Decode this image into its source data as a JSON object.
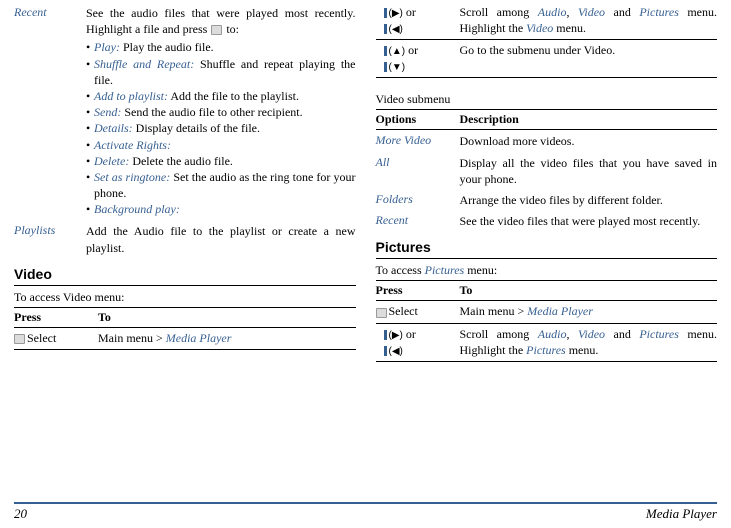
{
  "left": {
    "recent": {
      "label": "Recent",
      "desc_pre": "See the audio files that were played most recently. Highlight a file and press",
      "desc_post": "to:",
      "bullets": [
        {
          "term": "Play:",
          "desc": " Play the audio file."
        },
        {
          "term": "Shuffle and Repeat:",
          "desc": " Shuffle and repeat playing the file."
        },
        {
          "term": "Add to playlist:",
          "desc": " Add the file to the playlist."
        },
        {
          "term": "Send:",
          "desc": " Send the audio file to other recipient."
        },
        {
          "term": "Details:",
          "desc": " Display details of the file."
        },
        {
          "term": "Activate Rights:",
          "desc": ""
        },
        {
          "term": "Delete:",
          "desc": " Delete the audio file."
        },
        {
          "term": "Set as ringtone:",
          "desc": " Set the audio as the ring tone for your phone."
        },
        {
          "term": "Background play:",
          "desc": ""
        }
      ]
    },
    "playlists": {
      "label": "Playlists",
      "desc": "Add the Audio file to the playlist or create a new playlist."
    },
    "video_title": "Video",
    "video_sub": "To access Video menu:",
    "press": "Press",
    "to": "To",
    "select": "Select",
    "select_desc_pre": "Main menu > ",
    "select_desc_link": "Media Player"
  },
  "right": {
    "nav1": {
      "keys": "(▶) or (◀)",
      "desc_pre": "Scroll among ",
      "a1": "Audio",
      "c1": ", ",
      "a2": "Video",
      "c2": " and ",
      "a3": "Pictures",
      "desc_post": " menu. Highlight the ",
      "h": "Video",
      "desc_end": " menu."
    },
    "nav2": {
      "keys": "(▲) or (▼)",
      "desc": "Go to the submenu under Video."
    },
    "sub_title": "Video submenu",
    "options": "Options",
    "description": "Description",
    "more_video": {
      "label": "More Video",
      "desc": "Download more videos."
    },
    "all": {
      "label": "All",
      "desc": "Display all the video files that you have saved in your phone."
    },
    "folders": {
      "label": "Folders",
      "desc": "Arrange the video files by different folder."
    },
    "recent": {
      "label": "Recent",
      "desc": "See the video files that were played most recently."
    },
    "pictures_title": "Pictures",
    "pictures_sub_pre": "To access ",
    "pictures_sub_link": "Pictures",
    "pictures_sub_post": " menu:",
    "press": "Press",
    "to": "To",
    "select": "Select",
    "select_desc_pre": "Main menu > ",
    "select_desc_link": "Media Player",
    "nav3": {
      "keys": "(▶) or (◀)",
      "desc_pre": "Scroll among ",
      "a1": "Audio",
      "c1": ", ",
      "a2": "Video",
      "c2": " and ",
      "a3": "Pictures",
      "desc_post": " menu. Highlight the ",
      "h": "Pictures",
      "desc_end": " menu."
    }
  },
  "footer": {
    "page": "20",
    "chapter": "Media Player"
  }
}
